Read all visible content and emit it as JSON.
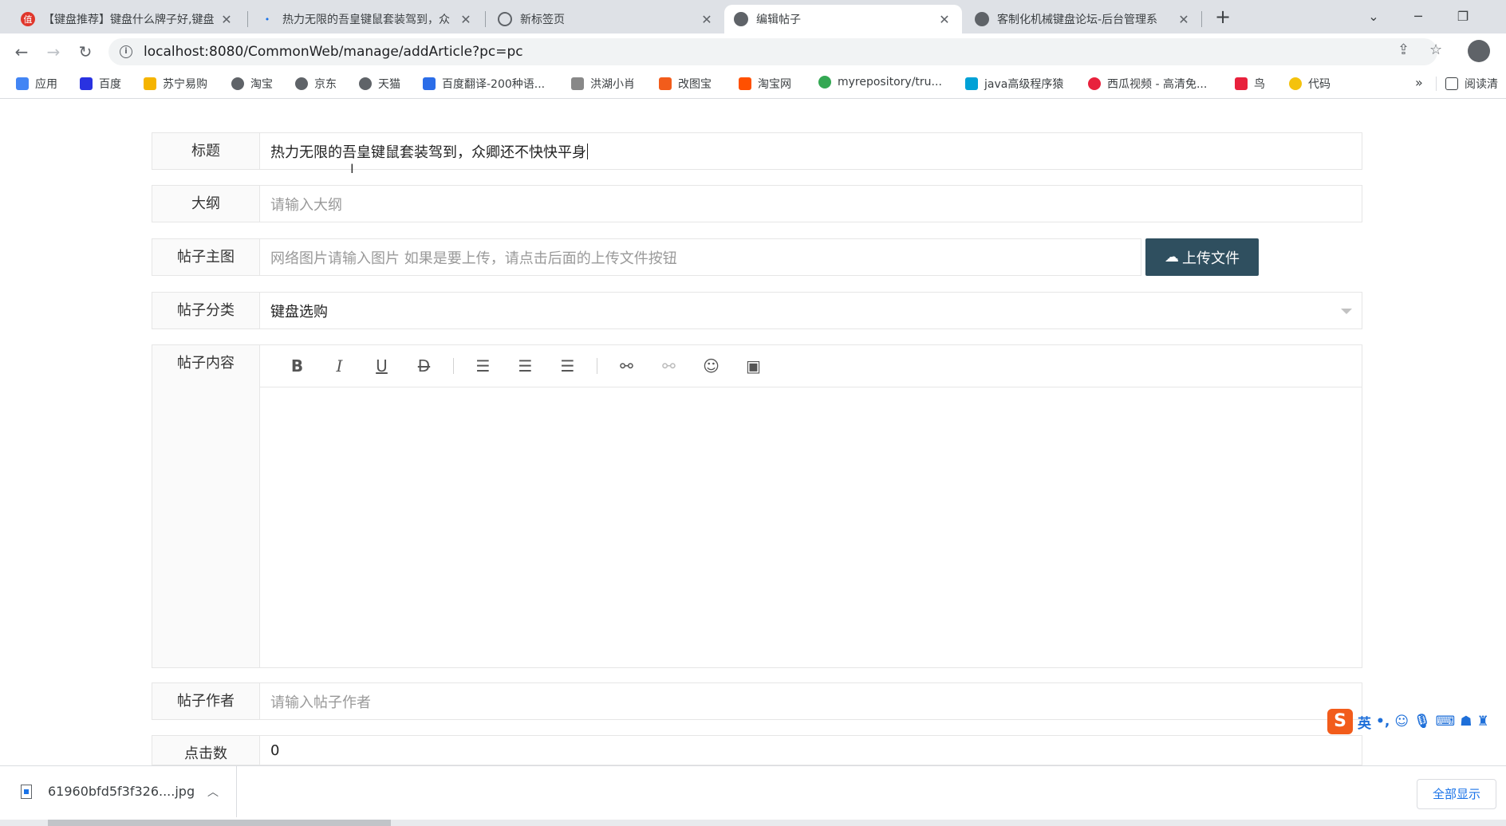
{
  "tabs": [
    {
      "title": "【键盘推荐】键盘什么牌子好,键盘",
      "favicon_color": "#e0362b",
      "favicon_glyph": "值"
    },
    {
      "title": "热力无限的吾皇键鼠套装驾到，众",
      "favicon_color": "#1a73e8",
      "favicon_glyph": ""
    },
    {
      "title": "新标签页",
      "favicon_color": "#5f6368",
      "favicon_glyph": ""
    },
    {
      "title": "编辑帖子",
      "favicon_color": "#5f6368",
      "favicon_glyph": ""
    },
    {
      "title": "客制化机械键盘论坛-后台管理系",
      "favicon_color": "#5f6368",
      "favicon_glyph": ""
    }
  ],
  "browser": {
    "url": "localhost:8080/CommonWeb/manage/addArticle?pc=pc",
    "new_tab": "+",
    "window_controls": {
      "dropdown": "⌄",
      "minimize": "─",
      "restore": "❐",
      "close": "✕"
    }
  },
  "bookmarks": [
    {
      "label": "应用",
      "color": "#4285f4"
    },
    {
      "label": "百度",
      "color": "#2932e1"
    },
    {
      "label": "苏宁易购",
      "color": "#f5b400"
    },
    {
      "label": "淘宝",
      "color": "#5f6368"
    },
    {
      "label": "京东",
      "color": "#5f6368"
    },
    {
      "label": "天猫",
      "color": "#5f6368"
    },
    {
      "label": "百度翻译-200种语...",
      "color": "#2b6de8"
    },
    {
      "label": "洪湖小肖",
      "color": "#888888"
    },
    {
      "label": "改图宝",
      "color": "#f25c1b"
    },
    {
      "label": "淘宝网",
      "color": "#ff5000"
    },
    {
      "label": "myrepository/tru...",
      "color": "#34a853"
    },
    {
      "label": "java高级程序猿",
      "color": "#00a1d6"
    },
    {
      "label": "西瓜视频 - 高清免...",
      "color": "#e8213c"
    },
    {
      "label": "鸟",
      "color": "#e8213c"
    },
    {
      "label": "代码",
      "color": "#f4c20d"
    }
  ],
  "bookmarks_more": "»",
  "reading_list": "阅读清",
  "form": {
    "title_label": "标题",
    "title_value": "热力无限的吾皇键鼠套装驾到，众卿还不快快平身",
    "outline_label": "大纲",
    "outline_placeholder": "请输入大纲",
    "image_label": "帖子主图",
    "image_placeholder": "网络图片请输入图片 如果是要上传，请点击后面的上传文件按钮",
    "upload_label": "上传文件",
    "category_label": "帖子分类",
    "category_value": "键盘选购",
    "content_label": "帖子内容",
    "author_label": "帖子作者",
    "author_placeholder": "请输入帖子作者",
    "clicks_label": "点击数",
    "clicks_value": "0"
  },
  "editor_toolbar": [
    "bold",
    "italic",
    "underline",
    "strikethrough",
    "align-left",
    "align-center",
    "align-right",
    "link",
    "unlink",
    "emoji",
    "image"
  ],
  "ime": {
    "logo": "S",
    "mode": "英",
    "punct": "•,"
  },
  "download": {
    "filename": "61960bfd5f3f326....jpg",
    "show_all": "全部显示"
  }
}
